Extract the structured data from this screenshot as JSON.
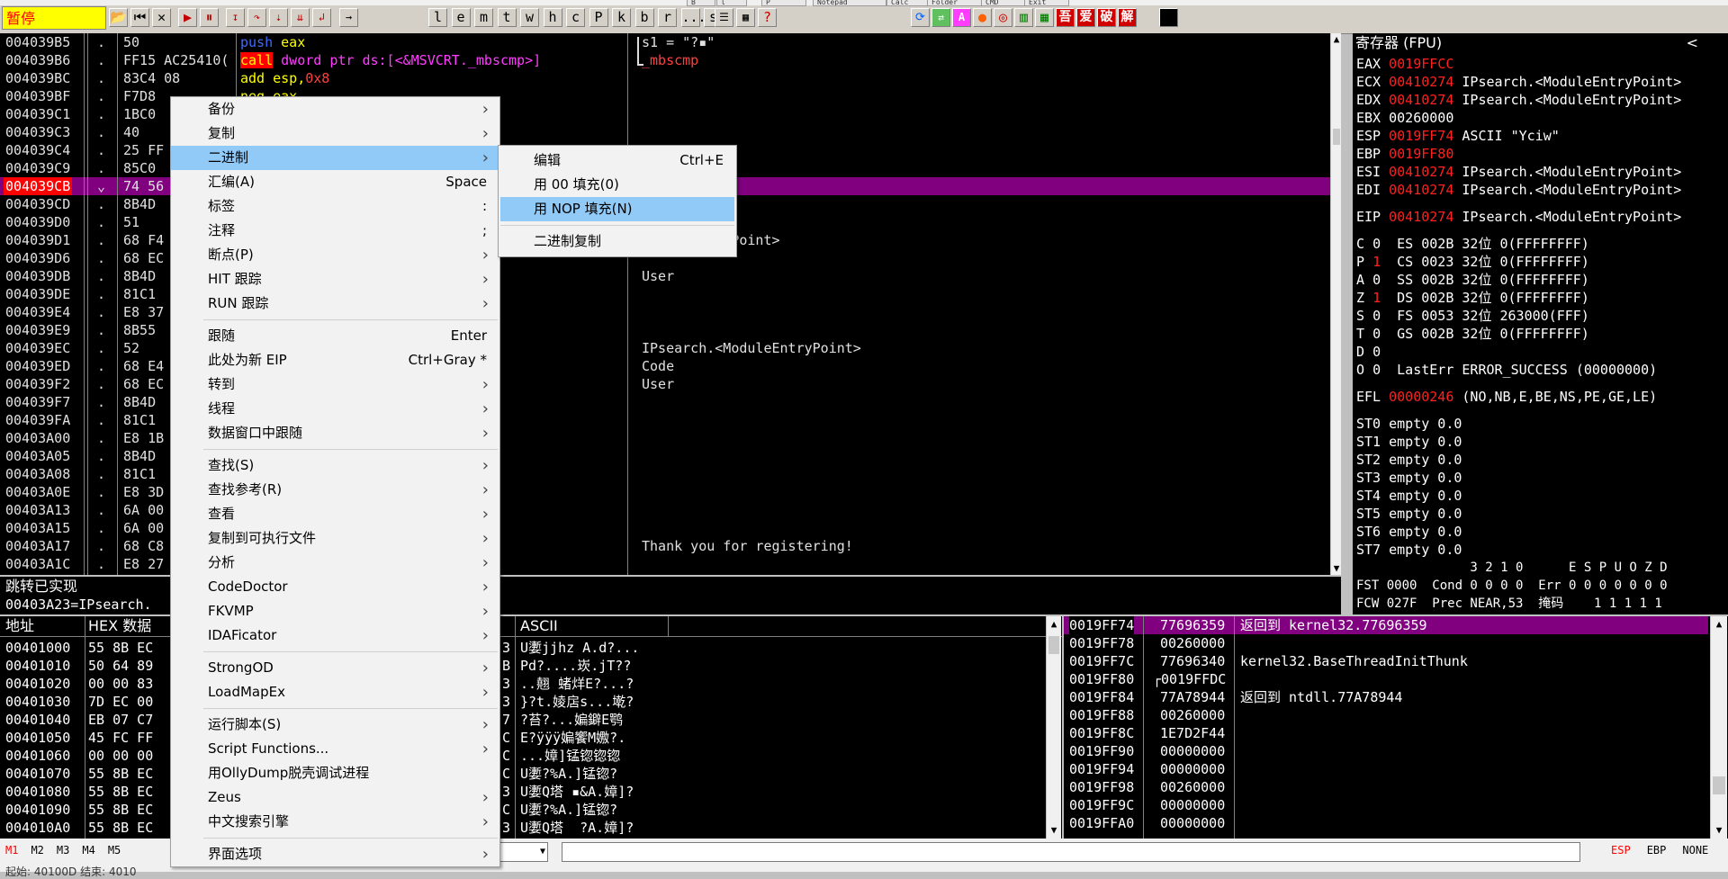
{
  "toolbar": {
    "top_tabs": [
      "B",
      "l",
      "P",
      "Notepad",
      "Calc",
      "Folder",
      "CMD",
      "Exit"
    ],
    "status": "暂停",
    "letter_buttons": [
      "l",
      "e",
      "m",
      "t",
      "w",
      "h",
      "c",
      "P",
      "k",
      "b",
      "r",
      "...",
      "s"
    ],
    "plugin_buttons": [
      "吾",
      "爱",
      "破",
      "解"
    ]
  },
  "cpu": {
    "rows": [
      {
        "addr": "004039B5",
        "sym": ".",
        "hex": "50",
        "asm": "push eax",
        "cmt": "s1 = \"?▪\""
      },
      {
        "addr": "004039B6",
        "sym": ".",
        "hex": "FF15 AC25410(",
        "asm": "call dword ptr ds:[<&MSVCRT._mbscmp>]",
        "cmt": "_mbscmp"
      },
      {
        "addr": "004039BC",
        "sym": ".",
        "hex": "83C4 08",
        "asm": "add esp,0x8",
        "cmt": ""
      },
      {
        "addr": "004039BF",
        "sym": ".",
        "hex": "F7D8",
        "asm": "neg eax",
        "cmt": ""
      },
      {
        "addr": "004039C1",
        "sym": ".",
        "hex": "1BC0",
        "asm": "",
        "cmt": ""
      },
      {
        "addr": "004039C3",
        "sym": ".",
        "hex": "40",
        "asm": "",
        "cmt": ""
      },
      {
        "addr": "004039C4",
        "sym": ".",
        "hex": "25 FF",
        "asm": "",
        "cmt": ""
      },
      {
        "addr": "004039C9",
        "sym": ".",
        "hex": "85C0",
        "asm": "",
        "cmt": ""
      },
      {
        "addr": "004039CB",
        "sym": "⌄",
        "hex": "74 56",
        "asm": "",
        "cmt": ""
      },
      {
        "addr": "004039CD",
        "sym": ".",
        "hex": "8B4D",
        "asm": "",
        "cmt": ""
      },
      {
        "addr": "004039D0",
        "sym": ".",
        "hex": "51",
        "asm": "",
        "cmt": ""
      },
      {
        "addr": "004039D1",
        "sym": ".",
        "hex": "68 F4",
        "asm": "",
        "cmt": "ModuleEntryPoint>"
      },
      {
        "addr": "004039D6",
        "sym": ".",
        "hex": "68 EC",
        "asm": "",
        "cmt": ""
      },
      {
        "addr": "004039DB",
        "sym": ".",
        "hex": "8B4D",
        "asm": "",
        "cmt": "User"
      },
      {
        "addr": "004039DE",
        "sym": ".",
        "hex": "81C1",
        "asm": "",
        "cmt": ""
      },
      {
        "addr": "004039E4",
        "sym": ".",
        "hex": "E8 37",
        "asm": "",
        "cmt": ""
      },
      {
        "addr": "004039E9",
        "sym": ".",
        "hex": "8B55",
        "asm": "",
        "cmt": ""
      },
      {
        "addr": "004039EC",
        "sym": ".",
        "hex": "52",
        "asm": "",
        "cmt": "IPsearch.<ModuleEntryPoint>"
      },
      {
        "addr": "004039ED",
        "sym": ".",
        "hex": "68 E4",
        "asm": "",
        "cmt": "Code"
      },
      {
        "addr": "004039F2",
        "sym": ".",
        "hex": "68 EC",
        "asm": "",
        "cmt": "User"
      },
      {
        "addr": "004039F7",
        "sym": ".",
        "hex": "8B4D",
        "asm": "",
        "cmt": ""
      },
      {
        "addr": "004039FA",
        "sym": ".",
        "hex": "81C1",
        "asm": "",
        "cmt": ""
      },
      {
        "addr": "00403A00",
        "sym": ".",
        "hex": "E8 1B",
        "asm": "",
        "cmt": ""
      },
      {
        "addr": "00403A05",
        "sym": ".",
        "hex": "8B4D",
        "asm": "",
        "cmt": ""
      },
      {
        "addr": "00403A08",
        "sym": ".",
        "hex": "81C1",
        "asm": "",
        "cmt": ""
      },
      {
        "addr": "00403A0E",
        "sym": ".",
        "hex": "E8 3D",
        "asm": "",
        "cmt": ""
      },
      {
        "addr": "00403A13",
        "sym": ".",
        "hex": "6A 00",
        "asm": "",
        "cmt": ""
      },
      {
        "addr": "00403A15",
        "sym": ".",
        "hex": "6A 00",
        "asm": "",
        "cmt": ""
      },
      {
        "addr": "00403A17",
        "sym": ".",
        "hex": "68 C8",
        "asm": "",
        "cmt": "Thank you for registering!"
      },
      {
        "addr": "00403A1C",
        "sym": ".",
        "hex": "E8 27",
        "asm": "",
        "cmt": ""
      }
    ],
    "selected_index": 8,
    "info_line1": "跳转已实现",
    "info_line2": "00403A23=IPsearch."
  },
  "registers": {
    "title": "寄存器 (FPU)",
    "collapse": "<",
    "gp": [
      {
        "name": "EAX",
        "val": "0019FFCC",
        "desc": "",
        "changed": true
      },
      {
        "name": "ECX",
        "val": "00410274",
        "desc": "IPsearch.<ModuleEntryPoint>",
        "changed": true
      },
      {
        "name": "EDX",
        "val": "00410274",
        "desc": "IPsearch.<ModuleEntryPoint>",
        "changed": true
      },
      {
        "name": "EBX",
        "val": "00260000",
        "desc": "",
        "changed": false
      },
      {
        "name": "ESP",
        "val": "0019FF74",
        "desc": "ASCII \"Yciw\"",
        "changed": true
      },
      {
        "name": "EBP",
        "val": "0019FF80",
        "desc": "",
        "changed": true
      },
      {
        "name": "ESI",
        "val": "00410274",
        "desc": "IPsearch.<ModuleEntryPoint>",
        "changed": true
      },
      {
        "name": "EDI",
        "val": "00410274",
        "desc": "IPsearch.<ModuleEntryPoint>",
        "changed": true
      }
    ],
    "eip": {
      "name": "EIP",
      "val": "00410274",
      "desc": "IPsearch.<ModuleEntryPoint>"
    },
    "flags": [
      {
        "f": "C",
        "v": "0",
        "seg": "ES 002B 32位 0(FFFFFFFF)",
        "changed": false
      },
      {
        "f": "P",
        "v": "1",
        "seg": "CS 0023 32位 0(FFFFFFFF)",
        "changed": true
      },
      {
        "f": "A",
        "v": "0",
        "seg": "SS 002B 32位 0(FFFFFFFF)",
        "changed": false
      },
      {
        "f": "Z",
        "v": "1",
        "seg": "DS 002B 32位 0(FFFFFFFF)",
        "changed": true
      },
      {
        "f": "S",
        "v": "0",
        "seg": "FS 0053 32位 263000(FFF)",
        "changed": false
      },
      {
        "f": "T",
        "v": "0",
        "seg": "GS 002B 32位 0(FFFFFFFF)",
        "changed": false
      },
      {
        "f": "D",
        "v": "0",
        "seg": "",
        "changed": false
      },
      {
        "f": "O",
        "v": "0",
        "seg": "LastErr ERROR_SUCCESS (00000000)",
        "changed": false
      }
    ],
    "efl": {
      "name": "EFL",
      "val": "00000246",
      "desc": "(NO,NB,E,BE,NS,PE,GE,LE)"
    },
    "fpu": [
      "ST0 empty 0.0",
      "ST1 empty 0.0",
      "ST2 empty 0.0",
      "ST3 empty 0.0",
      "ST4 empty 0.0",
      "ST5 empty 0.0",
      "ST6 empty 0.0",
      "ST7 empty 0.0"
    ],
    "fpu_hdr": "               3 2 1 0      E S P U O Z D",
    "fst": "FST 0000  Cond 0 0 0 0  Err 0 0 0 0 0 0 0",
    "fcw": "FCW 027F  Prec NEAR,53  掩码    1 1 1 1 1"
  },
  "dump": {
    "col_addr": "地址",
    "col_hex": "HEX 数据",
    "col_ascii": "ASCII",
    "rows": [
      {
        "addr": "00401000",
        "hex": "55 8B EC",
        "tail": "3",
        "ascii": "U嬱jjhz A.d?..."
      },
      {
        "addr": "00401010",
        "hex": "50 64 89",
        "tail": "B",
        "ascii": "Pd?....崁.jT??"
      },
      {
        "addr": "00401020",
        "hex": "00 00 83",
        "tail": "3",
        "ascii": "..翹 蝫烊E?...?"
      },
      {
        "addr": "00401030",
        "hex": "7D EC 00",
        "tail": "3",
        "ascii": "}?t.婈扂s...墘?"
      },
      {
        "addr": "00401040",
        "hex": "EB 07 C7",
        "tail": "7",
        "ascii": "?苔?...媥鐴E鹗"
      },
      {
        "addr": "00401050",
        "hex": "45 FC FF",
        "tail": "C",
        "ascii": "E?ÿÿÿ媥饗M嫐?."
      },
      {
        "addr": "00401060",
        "hex": "00 00 00",
        "tail": "C",
        "ascii": "...嫜]锰锪锪锪"
      },
      {
        "addr": "00401070",
        "hex": "55 8B EC",
        "tail": "C",
        "ascii": "U嬱?%A.]锰锪?"
      },
      {
        "addr": "00401080",
        "hex": "55 8B EC",
        "tail": "3",
        "ascii": "U嬱Q塔 ▪&A.嫜]?"
      },
      {
        "addr": "00401090",
        "hex": "55 8B EC",
        "tail": "C",
        "ascii": "U嬱?%A.]锰锪?"
      },
      {
        "addr": "004010A0",
        "hex": "55 8B EC",
        "tail": "3",
        "ascii": "U嬱Q塔  ?A.嫜]?"
      }
    ]
  },
  "stack": {
    "rows": [
      {
        "addr": "0019FF74",
        "val": "77696359",
        "cmt": "返回到 kernel32.77696359",
        "sel": true
      },
      {
        "addr": "0019FF78",
        "val": "00260000",
        "cmt": "",
        "sel": false
      },
      {
        "addr": "0019FF7C",
        "val": "77696340",
        "cmt": "kernel32.BaseThreadInitThunk",
        "sel": false
      },
      {
        "addr": "0019FF80",
        "val": "┌0019FFDC",
        "cmt": "",
        "sel": false
      },
      {
        "addr": "0019FF84",
        "val": "77A78944",
        "cmt": "返回到 ntdll.77A78944",
        "sel": false
      },
      {
        "addr": "0019FF88",
        "val": "00260000",
        "cmt": "",
        "sel": false
      },
      {
        "addr": "0019FF8C",
        "val": "1E7D2F44",
        "cmt": "",
        "sel": false
      },
      {
        "addr": "0019FF90",
        "val": "00000000",
        "cmt": "",
        "sel": false
      },
      {
        "addr": "0019FF94",
        "val": "00000000",
        "cmt": "",
        "sel": false
      },
      {
        "addr": "0019FF98",
        "val": "00260000",
        "cmt": "",
        "sel": false
      },
      {
        "addr": "0019FF9C",
        "val": "00000000",
        "cmt": "",
        "sel": false
      },
      {
        "addr": "0019FFA0",
        "val": "00000000",
        "cmt": "",
        "sel": false
      }
    ]
  },
  "context_menu": {
    "items": [
      {
        "label": "备份",
        "shortcut": "",
        "submenu": true,
        "sep_after": false
      },
      {
        "label": "复制",
        "shortcut": "",
        "submenu": true,
        "sep_after": false
      },
      {
        "label": "二进制",
        "shortcut": "",
        "submenu": true,
        "sep_after": false,
        "hl": true
      },
      {
        "label": "汇编(A)",
        "shortcut": "Space",
        "submenu": false,
        "sep_after": false
      },
      {
        "label": "标签",
        "shortcut": ":",
        "submenu": false,
        "sep_after": false
      },
      {
        "label": "注释",
        "shortcut": ";",
        "submenu": false,
        "sep_after": false
      },
      {
        "label": "断点(P)",
        "shortcut": "",
        "submenu": true,
        "sep_after": false
      },
      {
        "label": "HIT 跟踪",
        "shortcut": "",
        "submenu": true,
        "sep_after": false
      },
      {
        "label": "RUN 跟踪",
        "shortcut": "",
        "submenu": true,
        "sep_after": true
      },
      {
        "label": "跟随",
        "shortcut": "Enter",
        "submenu": false,
        "sep_after": false
      },
      {
        "label": "此处为新 EIP",
        "shortcut": "Ctrl+Gray *",
        "submenu": false,
        "sep_after": false
      },
      {
        "label": "转到",
        "shortcut": "",
        "submenu": true,
        "sep_after": false
      },
      {
        "label": "线程",
        "shortcut": "",
        "submenu": true,
        "sep_after": false
      },
      {
        "label": "数据窗口中跟随",
        "shortcut": "",
        "submenu": true,
        "sep_after": true
      },
      {
        "label": "查找(S)",
        "shortcut": "",
        "submenu": true,
        "sep_after": false
      },
      {
        "label": "查找参考(R)",
        "shortcut": "",
        "submenu": true,
        "sep_after": false
      },
      {
        "label": "查看",
        "shortcut": "",
        "submenu": true,
        "sep_after": false
      },
      {
        "label": "复制到可执行文件",
        "shortcut": "",
        "submenu": true,
        "sep_after": false
      },
      {
        "label": "分析",
        "shortcut": "",
        "submenu": true,
        "sep_after": false
      },
      {
        "label": "CodeDoctor",
        "shortcut": "",
        "submenu": true,
        "sep_after": false
      },
      {
        "label": "FKVMP",
        "shortcut": "",
        "submenu": true,
        "sep_after": false
      },
      {
        "label": "IDAFicator",
        "shortcut": "",
        "submenu": true,
        "sep_after": true
      },
      {
        "label": "StrongOD",
        "shortcut": "",
        "submenu": true,
        "sep_after": false
      },
      {
        "label": "LoadMapEx",
        "shortcut": "",
        "submenu": true,
        "sep_after": true
      },
      {
        "label": "运行脚本(S)",
        "shortcut": "",
        "submenu": true,
        "sep_after": false
      },
      {
        "label": "Script Functions...",
        "shortcut": "",
        "submenu": true,
        "sep_after": false
      },
      {
        "label": "用OllyDump脱壳调试进程",
        "shortcut": "",
        "submenu": false,
        "sep_after": false
      },
      {
        "label": "Zeus",
        "shortcut": "",
        "submenu": true,
        "sep_after": false
      },
      {
        "label": "中文搜索引擎",
        "shortcut": "",
        "submenu": true,
        "sep_after": true
      },
      {
        "label": "界面选项",
        "shortcut": "",
        "submenu": true,
        "sep_after": false
      }
    ]
  },
  "submenu": {
    "items": [
      {
        "label": "编辑",
        "shortcut": "Ctrl+E",
        "hl": false,
        "sep_after": false
      },
      {
        "label": "用 00 填充(0)",
        "shortcut": "",
        "hl": false,
        "sep_after": false
      },
      {
        "label": "用 NOP 填充(N)",
        "shortcut": "",
        "hl": true,
        "sep_after": true
      },
      {
        "label": "二进制复制",
        "shortcut": "",
        "hl": false,
        "sep_after": false
      }
    ]
  },
  "bottom": {
    "marks": [
      "M1",
      "M2",
      "M3",
      "M4",
      "M5"
    ],
    "right": [
      "ESP",
      "EBP",
      "NONE"
    ],
    "status": "起始: 40100D 结束: 4010"
  }
}
